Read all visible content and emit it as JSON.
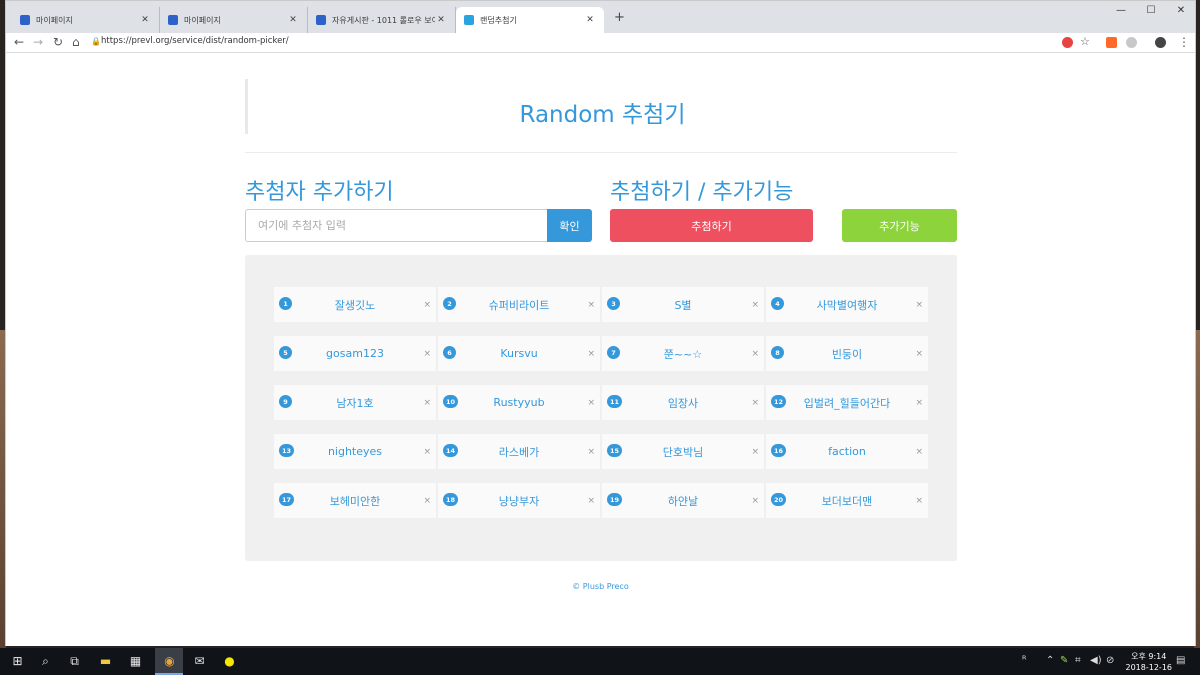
{
  "browser": {
    "tabs": [
      {
        "title": "마이페이지"
      },
      {
        "title": "마이페이지"
      },
      {
        "title": "자유게시판 - 1011 롤로우 보이"
      },
      {
        "title": "랜덤추첨기"
      }
    ],
    "url": "https://prevl.org/service/dist/random-picker/"
  },
  "page": {
    "title": "Random 추첨기",
    "add_heading": "추첨자 추가하기",
    "draw_heading": "추첨하기 / 추가기능",
    "input_placeholder": "여기에 추첨자 입력",
    "confirm_label": "확인",
    "draw_label": "추첨하기",
    "extra_label": "추가기능",
    "entries": [
      {
        "num": "1",
        "name": "잘생깃노"
      },
      {
        "num": "2",
        "name": "슈퍼비라이트"
      },
      {
        "num": "3",
        "name": "S별"
      },
      {
        "num": "4",
        "name": "사막별여행자"
      },
      {
        "num": "5",
        "name": "gosam123"
      },
      {
        "num": "6",
        "name": "Kursvu"
      },
      {
        "num": "7",
        "name": "쭌~~☆"
      },
      {
        "num": "8",
        "name": "빈둥이"
      },
      {
        "num": "9",
        "name": "남자1호"
      },
      {
        "num": "10",
        "name": "Rustyyub"
      },
      {
        "num": "11",
        "name": "임장사"
      },
      {
        "num": "12",
        "name": "입벌려_힐들어간다"
      },
      {
        "num": "13",
        "name": "nighteyes"
      },
      {
        "num": "14",
        "name": "라스베가"
      },
      {
        "num": "15",
        "name": "단호박님"
      },
      {
        "num": "16",
        "name": "faction"
      },
      {
        "num": "17",
        "name": "보헤미안한"
      },
      {
        "num": "18",
        "name": "냥냥부자"
      },
      {
        "num": "19",
        "name": "하얀날"
      },
      {
        "num": "20",
        "name": "보더보더맨"
      }
    ],
    "delete_glyph": "×",
    "footer": "© Plusb Preco"
  },
  "taskbar": {
    "clock_label": "오후 9:14",
    "date": "2018-12-16"
  },
  "colors": {
    "accent": "#3498db",
    "draw_button": "#ee5060",
    "extra_button": "#8dd33c"
  }
}
